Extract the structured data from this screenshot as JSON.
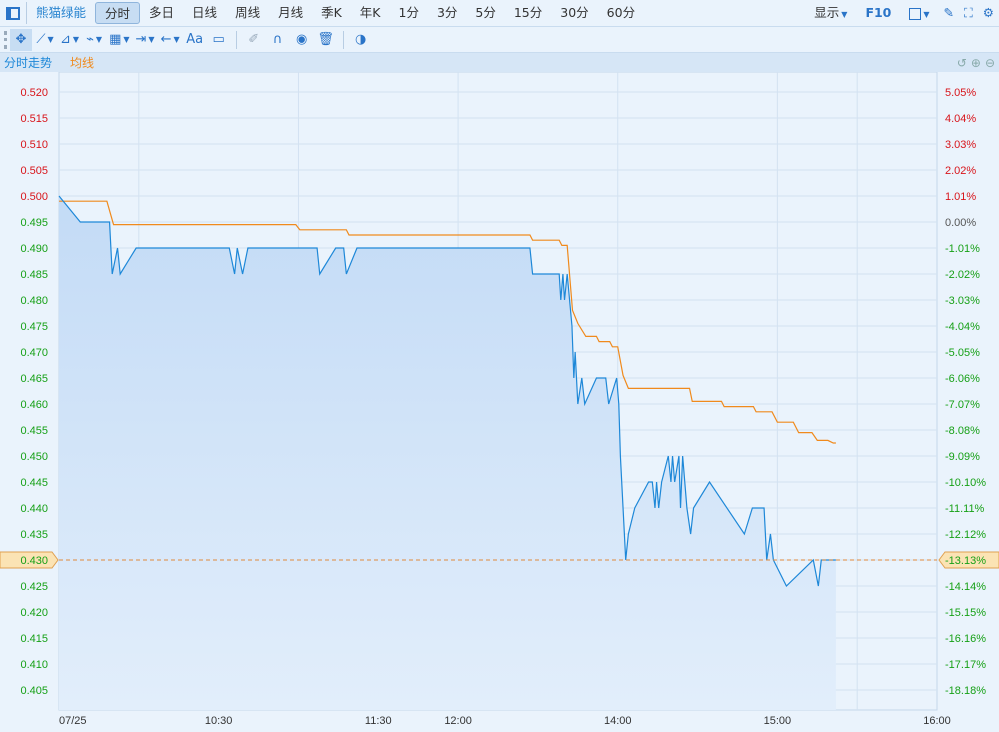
{
  "topbar": {
    "stock_name": "熊猫绿能",
    "tabs": [
      "分时",
      "多日",
      "日线",
      "周线",
      "月线",
      "季K",
      "年K",
      "1分",
      "3分",
      "5分",
      "15分",
      "30分",
      "60分"
    ],
    "active_tab": "分时",
    "display": "显示",
    "f10": "F10"
  },
  "toolbar": {
    "text_tool": "Aa",
    "icons": [
      "move-icon",
      "line-icon",
      "polyline-icon",
      "wave-icon",
      "fib-icon",
      "measure-icon",
      "arrow-icon",
      "text-icon",
      "comment-icon",
      "eraser-icon",
      "magnet-icon",
      "eye-icon",
      "trash-icon",
      "overlay-icon"
    ]
  },
  "legend": {
    "price_label": "分时走势",
    "avg_label": "均线"
  },
  "colors": {
    "price": "#1e88d8",
    "avg": "#f08a1c",
    "up": "#d8141a",
    "down": "#16a016",
    "ref": "#e08a3c"
  },
  "chart_data": {
    "type": "line",
    "title": "分时走势",
    "ylim": [
      0.4025,
      0.5225
    ],
    "y_ticks": [
      "0.520",
      "0.515",
      "0.510",
      "0.505",
      "0.500",
      "0.495",
      "0.490",
      "0.485",
      "0.480",
      "0.475",
      "0.470",
      "0.465",
      "0.460",
      "0.455",
      "0.450",
      "0.445",
      "0.440",
      "0.435",
      "0.430",
      "0.425",
      "0.420",
      "0.415",
      "0.410",
      "0.405"
    ],
    "pct_ticks": [
      "5.05%",
      "4.04%",
      "3.03%",
      "2.02%",
      "1.01%",
      "0.00%",
      "-1.01%",
      "-2.02%",
      "-3.03%",
      "-4.04%",
      "-5.05%",
      "-6.06%",
      "-7.07%",
      "-8.08%",
      "-9.09%",
      "-10.10%",
      "-11.11%",
      "-12.12%",
      "-13.13%",
      "-14.14%",
      "-15.15%",
      "-16.16%",
      "-17.17%",
      "-18.18%"
    ],
    "prev_close": 0.495,
    "current_price": "0.430",
    "current_pct": "-13.13%",
    "x_range_minutes": [
      0,
      330
    ],
    "x_ticks": [
      {
        "label": "07/25",
        "m": 0
      },
      {
        "label": "10:30",
        "m": 60
      },
      {
        "label": "11:30",
        "m": 120
      },
      {
        "label": "12:00",
        "m": 150
      },
      {
        "label": "14:00",
        "m": 210
      },
      {
        "label": "15:00",
        "m": 270
      },
      {
        "label": "16:00",
        "m": 330
      }
    ],
    "grid_minutes": [
      30,
      90,
      150,
      210,
      270,
      300
    ],
    "series": [
      {
        "name": "分时走势",
        "points": [
          [
            0,
            0.5
          ],
          [
            8,
            0.495
          ],
          [
            19,
            0.495
          ],
          [
            20,
            0.485
          ],
          [
            22,
            0.49
          ],
          [
            23,
            0.485
          ],
          [
            29,
            0.49
          ],
          [
            64,
            0.49
          ],
          [
            66,
            0.485
          ],
          [
            67,
            0.49
          ],
          [
            69,
            0.485
          ],
          [
            71,
            0.49
          ],
          [
            97,
            0.49
          ],
          [
            98,
            0.485
          ],
          [
            104,
            0.49
          ],
          [
            107,
            0.49
          ],
          [
            108,
            0.485
          ],
          [
            112,
            0.49
          ],
          [
            177,
            0.49
          ],
          [
            178,
            0.485
          ],
          [
            188,
            0.485
          ],
          [
            188.6,
            0.48
          ],
          [
            189.4,
            0.485
          ],
          [
            190,
            0.48
          ],
          [
            191,
            0.485
          ],
          [
            192.8,
            0.475
          ],
          [
            193.5,
            0.465
          ],
          [
            194,
            0.47
          ],
          [
            195,
            0.46
          ],
          [
            196.5,
            0.465
          ],
          [
            197.6,
            0.46
          ],
          [
            202,
            0.465
          ],
          [
            205.5,
            0.465
          ],
          [
            206.6,
            0.46
          ],
          [
            209.6,
            0.465
          ],
          [
            210.4,
            0.46
          ],
          [
            211,
            0.45
          ],
          [
            212,
            0.44
          ],
          [
            213,
            0.43
          ],
          [
            214,
            0.435
          ],
          [
            216.4,
            0.44
          ],
          [
            221.6,
            0.445
          ],
          [
            223,
            0.445
          ],
          [
            224,
            0.44
          ],
          [
            224.6,
            0.445
          ],
          [
            225.4,
            0.44
          ],
          [
            226.5,
            0.445
          ],
          [
            229,
            0.45
          ],
          [
            230,
            0.445
          ],
          [
            230.6,
            0.45
          ],
          [
            231.4,
            0.445
          ],
          [
            233,
            0.45
          ],
          [
            233.6,
            0.44
          ],
          [
            234.4,
            0.45
          ],
          [
            236,
            0.44
          ],
          [
            237.4,
            0.435
          ],
          [
            238.5,
            0.44
          ],
          [
            244.5,
            0.445
          ],
          [
            257.6,
            0.435
          ],
          [
            260.6,
            0.44
          ],
          [
            265,
            0.44
          ],
          [
            266,
            0.43
          ],
          [
            267.4,
            0.435
          ],
          [
            268.5,
            0.43
          ],
          [
            273.4,
            0.425
          ],
          [
            283.5,
            0.43
          ],
          [
            285.4,
            0.425
          ],
          [
            286.5,
            0.43
          ],
          [
            292,
            0.43
          ]
        ]
      },
      {
        "name": "均线",
        "points": [
          [
            0,
            0.499
          ],
          [
            18,
            0.499
          ],
          [
            20.5,
            0.4945
          ],
          [
            89,
            0.4945
          ],
          [
            90.5,
            0.4935
          ],
          [
            108,
            0.4935
          ],
          [
            109,
            0.4925
          ],
          [
            177,
            0.4925
          ],
          [
            178,
            0.4915
          ],
          [
            188,
            0.4915
          ],
          [
            189,
            0.4905
          ],
          [
            191,
            0.4905
          ],
          [
            193,
            0.478
          ],
          [
            195,
            0.4755
          ],
          [
            198,
            0.473
          ],
          [
            202,
            0.473
          ],
          [
            203,
            0.472
          ],
          [
            207,
            0.472
          ],
          [
            208,
            0.471
          ],
          [
            210,
            0.471
          ],
          [
            212,
            0.4655
          ],
          [
            214,
            0.463
          ],
          [
            237,
            0.463
          ],
          [
            238,
            0.4605
          ],
          [
            249,
            0.4605
          ],
          [
            250,
            0.4595
          ],
          [
            261,
            0.4595
          ],
          [
            262,
            0.4585
          ],
          [
            268,
            0.4585
          ],
          [
            270,
            0.4565
          ],
          [
            276,
            0.4565
          ],
          [
            278,
            0.4545
          ],
          [
            283,
            0.4545
          ],
          [
            285,
            0.453
          ],
          [
            289,
            0.453
          ],
          [
            291,
            0.4525
          ],
          [
            292,
            0.4525
          ]
        ]
      }
    ]
  }
}
